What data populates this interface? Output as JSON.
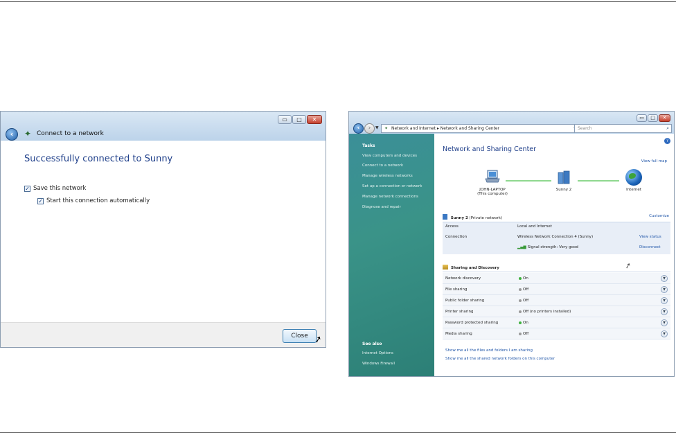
{
  "connect_window": {
    "title": "Connect to a network",
    "heading": "Successfully connected to Sunny",
    "save_network_label": "Save this network",
    "auto_start_label": "Start this connection automatically",
    "close_button": "Close",
    "window_buttons": {
      "minimize": "▭",
      "maximize": "□",
      "close": "✕"
    }
  },
  "sharing_window": {
    "address": {
      "segment1": "Network and Internet",
      "separator": "▸",
      "segment2": "Network and Sharing Center"
    },
    "search_placeholder": "Search",
    "window_buttons": {
      "minimize": "▭",
      "maximize": "□",
      "close": "✕"
    },
    "sidebar": {
      "tasks_title": "Tasks",
      "tasks": [
        "View computers and devices",
        "Connect to a network",
        "Manage wireless networks",
        "Set up a connection or network",
        "Manage network connections",
        "Diagnose and repair"
      ],
      "see_also_title": "See also",
      "see_also": [
        "Internet Options",
        "Windows Firewall"
      ]
    },
    "main": {
      "title": "Network and Sharing Center",
      "view_full_map": "View full map",
      "map": {
        "computer_name": "JOHN-LAPTOP",
        "computer_sub": "(This computer)",
        "network_name": "Sunny  2",
        "internet": "Internet"
      },
      "network": {
        "name": "Sunny  2",
        "type": "(Private network)",
        "customize": "Customize",
        "access_label": "Access",
        "access_value": "Local and Internet",
        "connection_label": "Connection",
        "connection_value": "Wireless Network Connection 4 (Sunny)",
        "view_status": "View status",
        "signal": "Signal strength:  Very good",
        "disconnect": "Disconnect"
      },
      "sharing": {
        "title": "Sharing and Discovery",
        "rows": [
          {
            "label": "Network discovery",
            "value": "On",
            "on": true
          },
          {
            "label": "File sharing",
            "value": "Off",
            "on": false
          },
          {
            "label": "Public folder sharing",
            "value": "Off",
            "on": false
          },
          {
            "label": "Printer sharing",
            "value": "Off (no printers installed)",
            "on": false
          },
          {
            "label": "Password protected sharing",
            "value": "On",
            "on": true
          },
          {
            "label": "Media sharing",
            "value": "Off",
            "on": false
          }
        ]
      },
      "links": [
        "Show me all the files and folders I am sharing",
        "Show me all the shared network folders on this computer"
      ]
    }
  },
  "colors": {
    "on_dot": "#3fb13f",
    "off_dot": "#9a9a9a",
    "link": "#1f55a8",
    "title_blue": "#1f3f8a",
    "sidebar_teal": "#3a9388"
  }
}
